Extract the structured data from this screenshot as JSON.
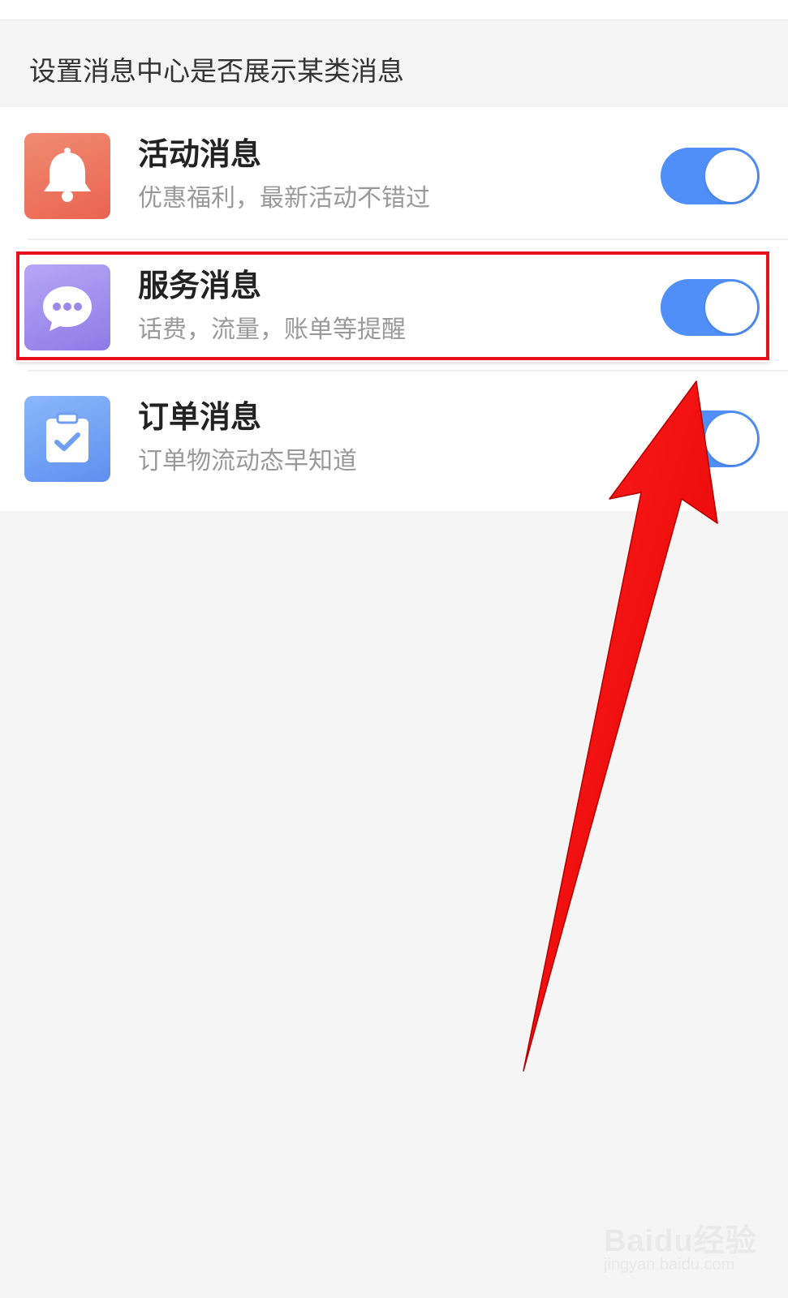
{
  "section": {
    "caption": "设置消息中心是否展示某类消息"
  },
  "rows": [
    {
      "title": "活动消息",
      "subtitle": "优惠福利，最新活动不错过",
      "icon": "bell-icon",
      "icon_color": "#EE7460",
      "toggle_on": true
    },
    {
      "title": "服务消息",
      "subtitle": "话费，流量，账单等提醒",
      "icon": "chat-bubble-icon",
      "icon_color": "#A18FEE",
      "toggle_on": true
    },
    {
      "title": "订单消息",
      "subtitle": "订单物流动态早知道",
      "icon": "clipboard-check-icon",
      "icon_color": "#6E9FF4",
      "toggle_on": true
    }
  ],
  "colors": {
    "toggle_on": "#4F8FF7",
    "annotation": "#E8101E",
    "background": "#F5F5F5"
  },
  "watermark": {
    "brand": "Baidu经验",
    "url": "jingyan.baidu.com"
  }
}
